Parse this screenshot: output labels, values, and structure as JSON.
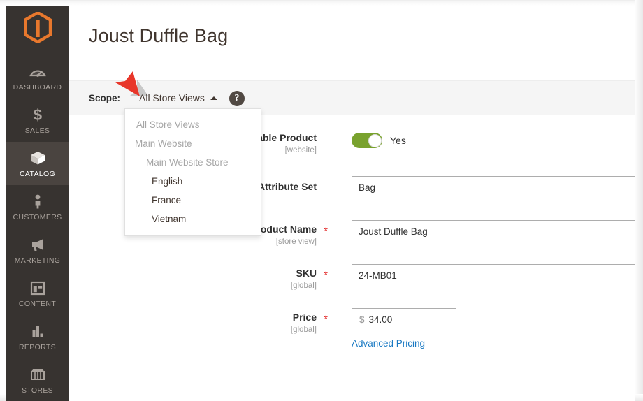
{
  "app": {
    "brand_logo": "magento-logo-icon",
    "accent_orange": "#e8782d",
    "sidebar_bg": "#373330",
    "link_color": "#1979c3",
    "toggle_on_color": "#79a22e",
    "required_star_color": "#e22626"
  },
  "sidebar": {
    "items": [
      {
        "label": "DASHBOARD",
        "icon": "dashboard-gauge-icon",
        "active": false
      },
      {
        "label": "SALES",
        "icon": "dollar-sign-icon",
        "active": false
      },
      {
        "label": "CATALOG",
        "icon": "box-package-icon",
        "active": true
      },
      {
        "label": "CUSTOMERS",
        "icon": "person-icon",
        "active": false
      },
      {
        "label": "MARKETING",
        "icon": "megaphone-icon",
        "active": false
      },
      {
        "label": "CONTENT",
        "icon": "layout-page-icon",
        "active": false
      },
      {
        "label": "REPORTS",
        "icon": "bar-chart-icon",
        "active": false
      },
      {
        "label": "STORES",
        "icon": "storefront-icon",
        "active": false
      }
    ]
  },
  "header": {
    "page_title": "Joust Duffle Bag"
  },
  "scope_bar": {
    "label": "Scope:",
    "current_value": "All Store Views",
    "caret_icon": "chevron-up-icon",
    "help_icon": "question-mark-icon",
    "help_glyph": "?"
  },
  "scope_dropdown": {
    "open": true,
    "options": [
      {
        "label": "All Store Views",
        "level": 0,
        "selectable": false
      },
      {
        "label": "Main Website",
        "level": 1,
        "selectable": false
      },
      {
        "label": "Main Website Store",
        "level": 2,
        "selectable": false
      },
      {
        "label": "English",
        "level": 3,
        "selectable": true
      },
      {
        "label": "France",
        "level": 3,
        "selectable": true
      },
      {
        "label": "Vietnam",
        "level": 3,
        "selectable": true
      }
    ]
  },
  "annotation": {
    "arrow_icon": "red-arrow-pointing-down-right",
    "color": "#e8362a"
  },
  "form": {
    "fields": [
      {
        "label": "Enable Product",
        "scope_note": "[website]",
        "required": false,
        "type": "toggle",
        "value": "Yes"
      },
      {
        "label": "Attribute Set",
        "scope_note": "",
        "required": false,
        "type": "text",
        "value": "Bag"
      },
      {
        "label": "Product Name",
        "scope_note": "[store view]",
        "required": true,
        "type": "text",
        "value": "Joust Duffle Bag"
      },
      {
        "label": "SKU",
        "scope_note": "[global]",
        "required": true,
        "type": "text",
        "value": "24-MB01"
      },
      {
        "label": "Price",
        "scope_note": "[global]",
        "required": true,
        "type": "price",
        "currency_symbol": "$",
        "value": "34.00"
      }
    ],
    "advanced_pricing_link": "Advanced Pricing"
  }
}
